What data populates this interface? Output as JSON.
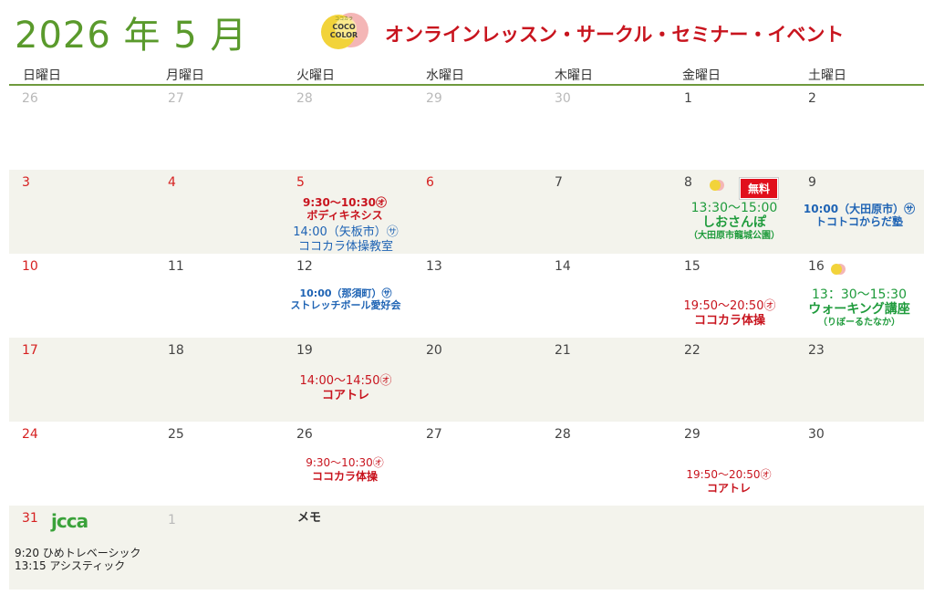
{
  "header": {
    "month_title": "2026 年 5 月",
    "subtitle": "オンラインレッスン・サークル・セミナー・イベント",
    "logo_text_top": "ココカラ",
    "logo_text_main1": "COCO",
    "logo_text_main2": "COLOR"
  },
  "weekdays": [
    "日曜日",
    "月曜日",
    "火曜日",
    "水曜日",
    "木曜日",
    "金曜日",
    "土曜日"
  ],
  "weeks": [
    [
      "26",
      "27",
      "28",
      "29",
      "30",
      "1",
      "2"
    ],
    [
      "3",
      "4",
      "5",
      "6",
      "7",
      "8",
      "9"
    ],
    [
      "10",
      "11",
      "12",
      "13",
      "14",
      "15",
      "16"
    ],
    [
      "17",
      "18",
      "19",
      "20",
      "21",
      "22",
      "23"
    ],
    [
      "24",
      "25",
      "26",
      "27",
      "28",
      "29",
      "30"
    ],
    [
      "31",
      "1"
    ]
  ],
  "events": {
    "tue5_a_time": "9:30～10:30㋔",
    "tue5_a_name": "ボディキネシス",
    "tue5_b_time": "14:00（矢板市）㋚",
    "tue5_b_name": "ココカラ体操教室",
    "fri8_badge": "無料",
    "fri8_time": "13:30～15:00",
    "fri8_name": "しおさんぽ",
    "fri8_place": "（大田原市龍城公園）",
    "sat9_time": "10:00（大田原市）㋚",
    "sat9_name": "トコトコからだ塾",
    "tue12_time": "10:00（那須町）㋚",
    "tue12_name": "ストレッチボール愛好会",
    "fri15_time": "19:50～20:50㋔",
    "fri15_name": "ココカラ体操",
    "sat16_time": "13：30～15:30",
    "sat16_name": "ウォーキング講座",
    "sat16_place": "（りぼーるたなか）",
    "tue19_time": "14:00～14:50㋔",
    "tue19_name": "コアトレ",
    "tue26_time": "9:30～10:30㋔",
    "tue26_name": "ココカラ体操",
    "fri29_time": "19:50～20:50㋔",
    "fri29_name": "コアトレ",
    "sun31_logo": "jcca",
    "sun31_line1": "9:20 ひめトレベーシック",
    "sun31_line2": "13:15 アシスティック",
    "memo_label": "メモ"
  },
  "colors": {
    "title_green": "#5a9a2c",
    "accent_red": "#c8141e",
    "event_blue": "#1e63b4",
    "event_green": "#1f9b3c",
    "sunday_red": "#d62020",
    "row_shade": "#f3f3ec"
  }
}
